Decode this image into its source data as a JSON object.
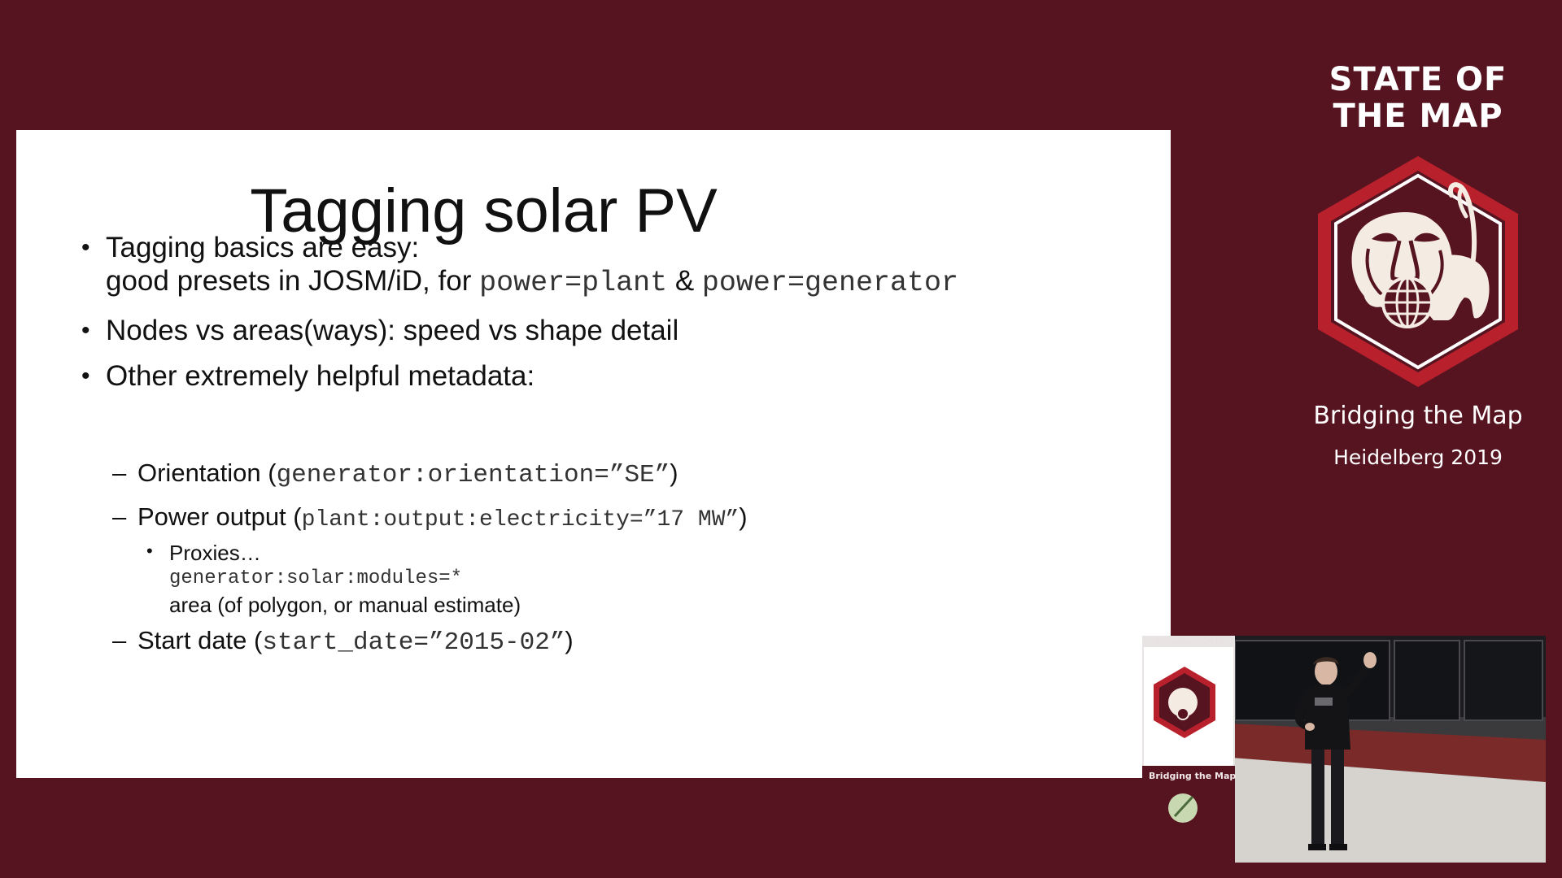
{
  "slide": {
    "title": "Tagging solar PV",
    "bullets": [
      {
        "line1": "Tagging basics are easy:",
        "line2_prefix": "good presets in JOSM/iD, for ",
        "code1": "power=plant",
        "amp": " & ",
        "code2": "power=generator"
      },
      {
        "text": "Nodes vs areas(ways): speed vs shape detail"
      },
      {
        "text": "Other extremely helpful metadata:"
      }
    ],
    "sub_bullets": [
      {
        "label": "Orientation (",
        "code": "generator:orientation=”SE”",
        "close": ")"
      },
      {
        "label": "Power output (",
        "code": "plant:output:electricity=”17 MW”",
        "close": ")"
      },
      {
        "label": "Start date (",
        "code": "start_date=”2015-02”",
        "close": ")"
      }
    ],
    "proxies": {
      "label": "Proxies…",
      "code": "generator:solar:modules=*",
      "area": "area (of polygon, or manual estimate)"
    },
    "bullet_char": "•",
    "dash_char": "–"
  },
  "branding": {
    "title_line1": "STATE OF",
    "title_line2": "THE MAP",
    "subtitle": "Bridging the Map",
    "event": "Heidelberg 2019",
    "logo_icon": "state-of-the-map-lion-icon"
  },
  "camera": {
    "banner_top": "Heidelberg 2019",
    "banner_text": "Bridging the Map"
  },
  "colors": {
    "background": "#561320",
    "slide": "#ffffff",
    "logo_red": "#b8202c",
    "text": "#111111"
  }
}
